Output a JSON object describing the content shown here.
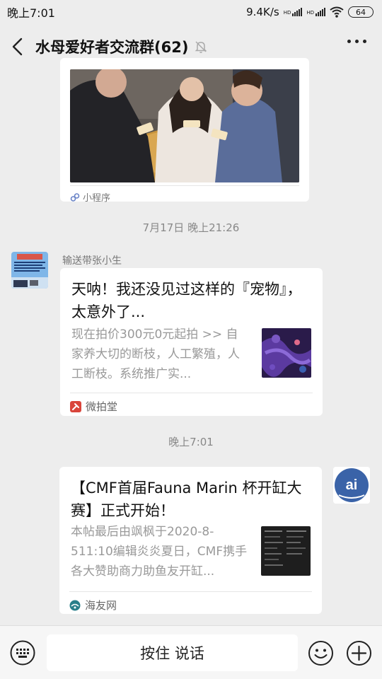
{
  "status_bar": {
    "time": "晚上7:01",
    "network_speed": "9.4K/s",
    "sim1": "HD",
    "sim2": "HD",
    "battery": "64"
  },
  "header": {
    "title": "水母爱好者交流群(62)",
    "back_icon": "chevron-left-icon",
    "mute_icon": "bell-off-icon",
    "more_icon": "ellipsis-icon"
  },
  "messages": {
    "card1": {
      "footer_label": "小程序"
    },
    "timestamp1": "7月17日 晚上21:26",
    "msg2": {
      "sender": "输送带张小生",
      "title": "天呐！我还没见过这样的『宠物』，太意外了...",
      "desc": "现在拍价300元0元起拍 >> 自家养大切的断枝，人工繁殖，人工断枝。系统推广实...",
      "source": "微拍堂"
    },
    "timestamp2": "晚上7:01",
    "msg3": {
      "title": "【CMF首届Fauna Marin 杯开缸大赛】正式开始！",
      "desc": "本帖最后由飒枫于2020-8-511:10编辑炎炎夏日，CMF携手各大赞助商力助鱼友开缸...",
      "source": "海友网",
      "avatar_text": "ai"
    }
  },
  "input_bar": {
    "hold_to_talk": "按住 说话"
  },
  "colors": {
    "background": "#ededed",
    "bubble": "#ffffff",
    "text": "#111111",
    "muted": "#888888",
    "source_red": "#d9453b",
    "source_teal": "#2a7f8a"
  }
}
